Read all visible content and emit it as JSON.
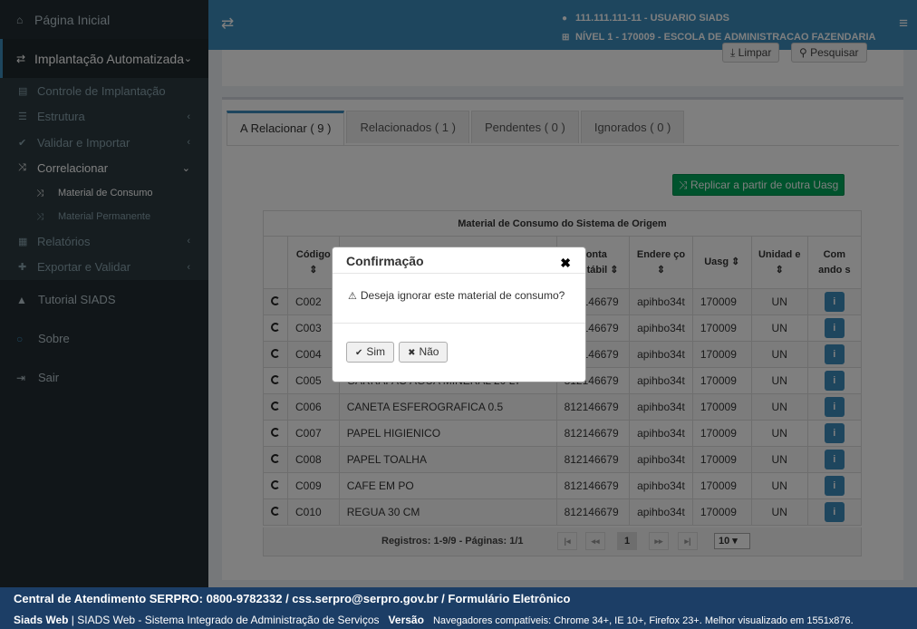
{
  "sidebar": {
    "home": "Página Inicial",
    "implantacao": "Implantação Automatizada",
    "controle": "Controle de Implantação",
    "estrutura": "Estrutura",
    "validar_importar": "Validar e Importar",
    "correlacionar": "Correlacionar",
    "material_consumo": "Material de Consumo",
    "material_permanente": "Material Permanente",
    "relatorios": "Relatórios",
    "exportar_validar": "Exportar e Validar",
    "tutorial": "Tutorial SIADS",
    "sobre": "Sobre",
    "sair": "Sair"
  },
  "header": {
    "user": "111.111.111-11 - USUARIO SIADS",
    "nivel": "NÍVEL 1 - 170009 - ESCOLA DE ADMINISTRACAO FAZENDARIA"
  },
  "toolbar": {
    "limpar": "Limpar",
    "pesquisar": "Pesquisar"
  },
  "tabs": [
    "A Relacionar ( 9 )",
    "Relacionados ( 1 )",
    "Pendentes ( 0 )",
    "Ignorados ( 0 )"
  ],
  "replicar": "Replicar a partir de outra Uasg",
  "table": {
    "title": "Material de Consumo do Sistema de Origem",
    "headers": {
      "codigo": "Código ⇕",
      "conta": "Conta Contábil ⇕",
      "endereco": "Endere ço ⇕",
      "uasg": "Uasg ⇕",
      "unidade": "Unidad e ⇕",
      "comandos": "Com ando s"
    },
    "rows": [
      {
        "codigo": "C002",
        "descricao": "",
        "conta": "812146679",
        "endereco": "apihbo34t",
        "uasg": "170009",
        "unidade": "UN"
      },
      {
        "codigo": "C003",
        "descricao": "",
        "conta": "812146679",
        "endereco": "apihbo34t",
        "uasg": "170009",
        "unidade": "UN"
      },
      {
        "codigo": "C004",
        "descricao": "",
        "conta": "812146679",
        "endereco": "apihbo34t",
        "uasg": "170009",
        "unidade": "UN"
      },
      {
        "codigo": "C005",
        "descricao": "GARRAFAO AGUA MINERAL 20 LT",
        "conta": "812146679",
        "endereco": "apihbo34t",
        "uasg": "170009",
        "unidade": "UN"
      },
      {
        "codigo": "C006",
        "descricao": "CANETA ESFEROGRAFICA 0.5",
        "conta": "812146679",
        "endereco": "apihbo34t",
        "uasg": "170009",
        "unidade": "UN"
      },
      {
        "codigo": "C007",
        "descricao": "PAPEL HIGIENICO",
        "conta": "812146679",
        "endereco": "apihbo34t",
        "uasg": "170009",
        "unidade": "UN"
      },
      {
        "codigo": "C008",
        "descricao": "PAPEL TOALHA",
        "conta": "812146679",
        "endereco": "apihbo34t",
        "uasg": "170009",
        "unidade": "UN"
      },
      {
        "codigo": "C009",
        "descricao": "CAFE EM PO",
        "conta": "812146679",
        "endereco": "apihbo34t",
        "uasg": "170009",
        "unidade": "UN"
      },
      {
        "codigo": "C010",
        "descricao": "REGUA 30 CM",
        "conta": "812146679",
        "endereco": "apihbo34t",
        "uasg": "170009",
        "unidade": "UN"
      }
    ]
  },
  "pager": {
    "text": "Registros: 1-9/9 - Páginas: 1/1",
    "page": "1",
    "per_page": "10"
  },
  "modal": {
    "title": "Confirmação",
    "message": "Deseja ignorar este material de consumo?",
    "yes": "Sim",
    "no": "Não"
  },
  "footer": {
    "line1": "Central de Atendimento SERPRO: 0800-9782332 / css.serpro@serpro.gov.br / Formulário Eletrônico",
    "app": "Siads Web",
    "desc": " | SIADS Web - Sistema Integrado de Administração de Serviços",
    "versao": "Versão",
    "browsers": "Navegadores compatíveis: Chrome 34+, IE 10+, Firefox 23+. Melhor visualizado em 1551x876."
  }
}
